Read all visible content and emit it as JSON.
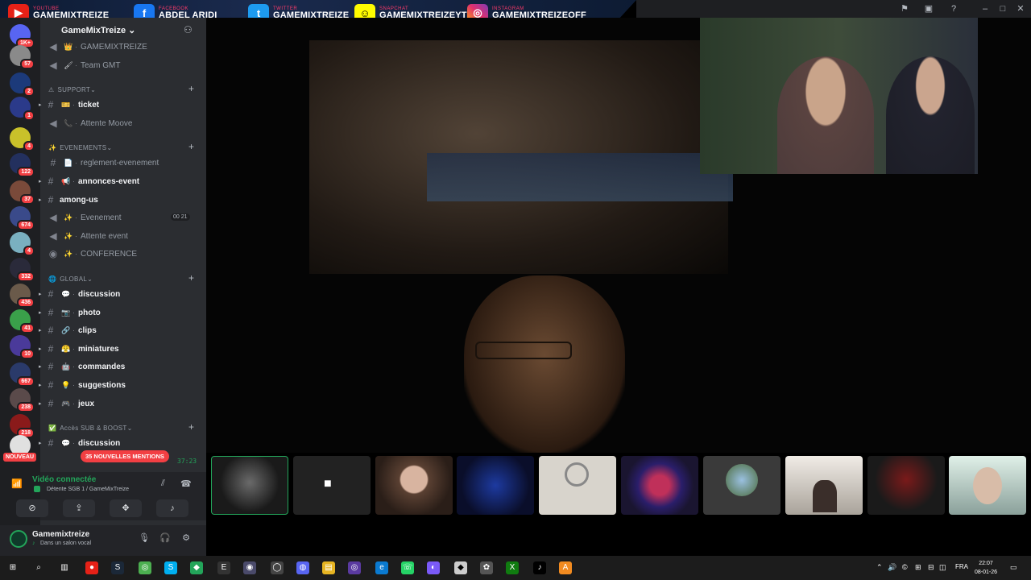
{
  "banner": {
    "youtube": {
      "label": "YOUTUBE",
      "name": "GAMEMIXTREIZE"
    },
    "facebook": {
      "label": "FACEBOOK",
      "name": "ABDEL ARIDI"
    },
    "twitter": {
      "label": "TWITTER",
      "name": "GAMEMIXTREIZE"
    },
    "snapchat": {
      "label": "SNAPCHAT",
      "name": "GAMEMIXTREIZEYT"
    },
    "instagram": {
      "label": "INSTAGRAM",
      "name": "GAMEMIXTREIZEOFF"
    }
  },
  "rail": {
    "badges": [
      "1K+",
      "57",
      "2",
      "1",
      "4",
      "122",
      "37",
      "674",
      "4",
      "332",
      "436",
      "41",
      "10",
      "667",
      "238",
      "218"
    ],
    "nouveau": "NOUVEAU"
  },
  "server": {
    "name": "GameMixTreize"
  },
  "channels": {
    "gmt": "GAMEMIXTREIZE",
    "team": "Team GMT",
    "support_cat": "SUPPORT",
    "ticket": "ticket",
    "attente_moove": "Attente Moove",
    "events_cat": "EVENEMENTS",
    "reglement": "reglement-evenement",
    "annonces": "annonces-event",
    "among": "among-us",
    "evenement": "Evenement",
    "evenement_count_a": "00",
    "evenement_count_b": "21",
    "attente_event": "Attente event",
    "conference": "CONFERENCE",
    "global_cat": "GLOBAL",
    "discussion": "discussion",
    "photo": "photo",
    "clips": "clips",
    "miniatures": "miniatures",
    "commandes": "commandes",
    "suggestions": "suggestions",
    "jeux": "jeux",
    "sub_cat": "Accès SUB & BOOST",
    "discussion2": "discussion"
  },
  "mentions": "35 NOUVELLES MENTIONS",
  "timer": "37:23",
  "voice": {
    "status": "Vidéo connectée",
    "channel": "Détente SGB 1 / GameMixTreize"
  },
  "user": {
    "name": "Gamemixtreize",
    "status": "Dans un salon vocal"
  },
  "taskbar": {
    "lang": "FRA",
    "time": "22:07",
    "date": "08-01-26"
  },
  "colors": {
    "accent_green": "#23a55a",
    "mention_red": "#f23f43",
    "sidebar": "#2b2d31",
    "rail": "#1e1f22"
  }
}
